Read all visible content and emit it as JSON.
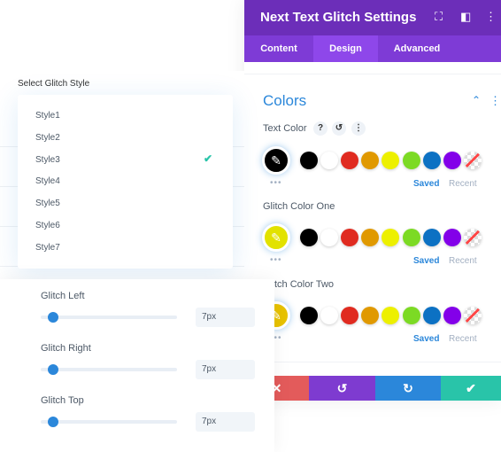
{
  "header": {
    "title": "Next Text Glitch Settings",
    "icons": [
      "fullscreen-icon",
      "sidebar-layout-icon",
      "more-vertical-icon"
    ]
  },
  "tabs": [
    {
      "label": "Content"
    },
    {
      "label": "Design",
      "active": true
    },
    {
      "label": "Advanced"
    }
  ],
  "colors_section": {
    "title": "Colors",
    "groups": [
      {
        "label": "Text Color",
        "current": "#000000",
        "saved": "Saved",
        "recent": "Recent"
      },
      {
        "label": "Glitch Color One",
        "current": "#e2e200",
        "saved": "Saved",
        "recent": "Recent"
      },
      {
        "label": "Glitch Color Two",
        "label_visible": "tch Color Two",
        "current": "#e8c200",
        "saved": "Saved",
        "recent": "Recent"
      }
    ],
    "palette": [
      "#000000",
      "#ffffff",
      "#e02b20",
      "#e09900",
      "#edf000",
      "#7cda24",
      "#0c71c3",
      "#8300e9",
      "transparent"
    ]
  },
  "select": {
    "label": "Select Glitch Style",
    "options": [
      "Style1",
      "Style2",
      "Style3",
      "Style4",
      "Style5",
      "Style6",
      "Style7"
    ],
    "selected": "Style3"
  },
  "sliders": [
    {
      "label": "Glitch Left",
      "value": "7px"
    },
    {
      "label": "Glitch Right",
      "value": "7px"
    },
    {
      "label": "Glitch Top",
      "value": "7px"
    }
  ],
  "footer": {
    "colors": {
      "cancel": "#e35b5b",
      "undo": "#7e3bd0",
      "redo": "#2b87da",
      "save": "#29c4a9"
    }
  },
  "accent": "#2b87da"
}
